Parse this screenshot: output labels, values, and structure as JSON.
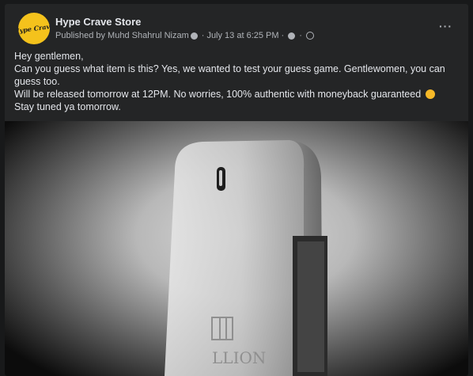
{
  "post": {
    "page_name": "Hype Crave Store",
    "avatar_text": "Hype Crave",
    "published_by": "Published by Muhd Shahrul Nizam",
    "date": "July 13 at 6:25 PM",
    "separator": "·",
    "more_label": "···",
    "lines": [
      "Hey gentlemen,",
      "Can you guess what item is this? Yes, we wanted to test your guess game. Gentlewomen, you can guess too.",
      "Will be released tomorrow at 12PM. No worries, 100% authentic with moneyback guaranteed",
      "Stay tuned ya tomorrow."
    ]
  },
  "photo": {
    "bottle_text": "LLION",
    "icons": [
      "info-icon",
      "settings-icon",
      "globe-icon",
      "smile-emoji-icon"
    ]
  }
}
